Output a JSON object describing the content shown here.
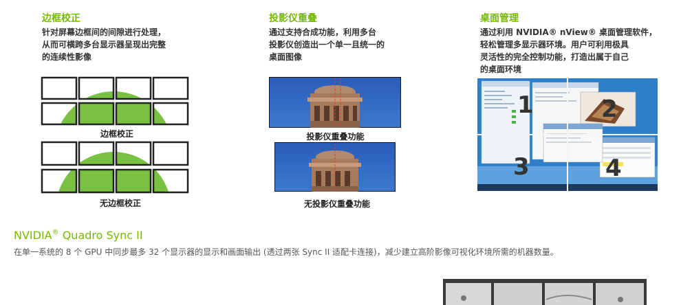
{
  "features": [
    {
      "title": "边框校正",
      "desc": "针对屏幕边框间的间隙进行处理，\n从而可横跨多台显示器呈现出完整\n的连续性影像"
    },
    {
      "title": "投影仪重叠",
      "desc": "通过支持合成功能，利用多台\n投影仪创造出一个单一且统一的\n桌面图像"
    },
    {
      "title": "桌面管理",
      "desc": "通过利用 NVIDIA® nView® 桌面管理软件，\n轻松管理多显示器环境。用户可利用极具\n灵活性的完全控制功能，打造出属于自己\n的桌面环境"
    }
  ],
  "captions": {
    "bezel_corrected": "边框校正",
    "no_bezel_correction": "无边框校正",
    "overlap": "投影仪重叠功能",
    "no_overlap": "无投影仪重叠功能"
  },
  "desktop_numbers": [
    "1",
    "2",
    "3",
    "4"
  ],
  "sync": {
    "title_main": "NVIDIA",
    "title_reg": "®",
    "title_rest": " Quadro Sync II",
    "desc": "在单一系统的 8 个 GPU 中同步最多 32 个显示器的显示和画面输出 (透过两张 Sync II 适配卡连接)，减少建立高阶影像可视化环境所需的机器数量。"
  },
  "colors": {
    "accent": "#76b900",
    "text": "#333333",
    "sky": "#1f4fa6"
  }
}
